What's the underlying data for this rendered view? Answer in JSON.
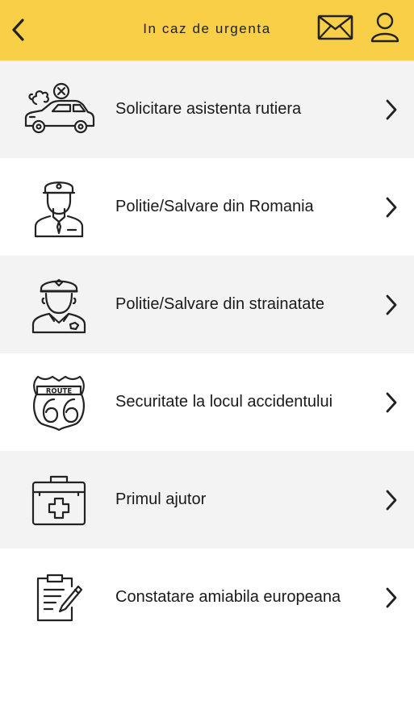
{
  "header": {
    "title": "In caz de urgenta",
    "back_icon": "chevron-left-icon",
    "mail_icon": "envelope-icon",
    "user_icon": "user-icon",
    "background_color": "#f9cf47"
  },
  "menu": {
    "items": [
      {
        "label": "Solicitare asistenta rutiera",
        "icon": "broken-car-icon"
      },
      {
        "label": "Politie/Salvare din Romania",
        "icon": "policeman-icon"
      },
      {
        "label": "Politie/Salvare din strainatate",
        "icon": "police-officer-icon"
      },
      {
        "label": "Securitate la locul accidentului",
        "icon": "route-66-sign-icon"
      },
      {
        "label": "Primul ajutor",
        "icon": "first-aid-kit-icon"
      },
      {
        "label": "Constatare amiabila europeana",
        "icon": "clipboard-form-icon"
      }
    ]
  }
}
